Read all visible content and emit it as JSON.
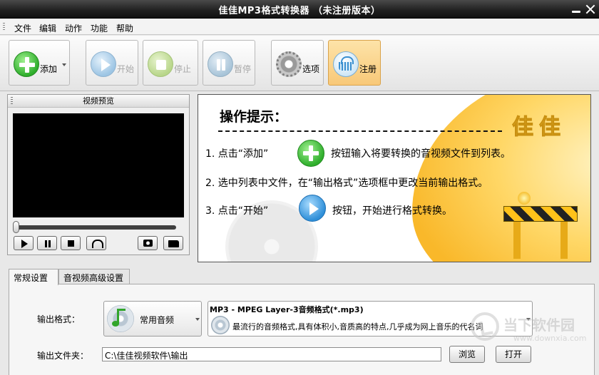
{
  "window": {
    "title": "佳佳MP3格式转换器  （未注册版本）"
  },
  "menu": {
    "items": [
      "文件",
      "编辑",
      "动作",
      "功能",
      "帮助"
    ]
  },
  "toolbar": {
    "add_label": "添加",
    "start_label": "开始",
    "stop_label": "停止",
    "pause_label": "暂停",
    "options_label": "选项",
    "register_label": "注册"
  },
  "preview": {
    "title": "视频预览",
    "seek_position": 0
  },
  "hints": {
    "title": "操作提示：",
    "step1_a": "1. 点击“添加”",
    "step1_b": "按钮输入将要转换的音视频文件到列表。",
    "step2": "2. 选中列表中文件，在“输出格式”选项框中更改当前输出格式。",
    "step3_a": "3. 点击“开始”",
    "step3_b": "按钮，开始进行格式转换。",
    "brand": "佳佳"
  },
  "tabs": [
    "常规设置",
    "音视频高级设置"
  ],
  "settings": {
    "format_label": "输出格式：",
    "category": "常用音频",
    "format_name": "MP3 - MPEG Layer-3音频格式(*.mp3)",
    "format_desc": "最流行的音频格式,具有体积小,音质高的特点,几乎成为网上音乐的代名词",
    "folder_label": "输出文件夹：",
    "folder_value": "C:\\佳佳视频软件\\输出",
    "browse_label": "浏览",
    "open_label": "打开"
  },
  "watermark": {
    "text": "当下软件园",
    "url": "www.downxia.com"
  },
  "colors": {
    "accent": "#f8c878",
    "hint_yellow": "#f9b82a",
    "add_green": "#2fae2c",
    "play_blue": "#2f8fd8"
  }
}
